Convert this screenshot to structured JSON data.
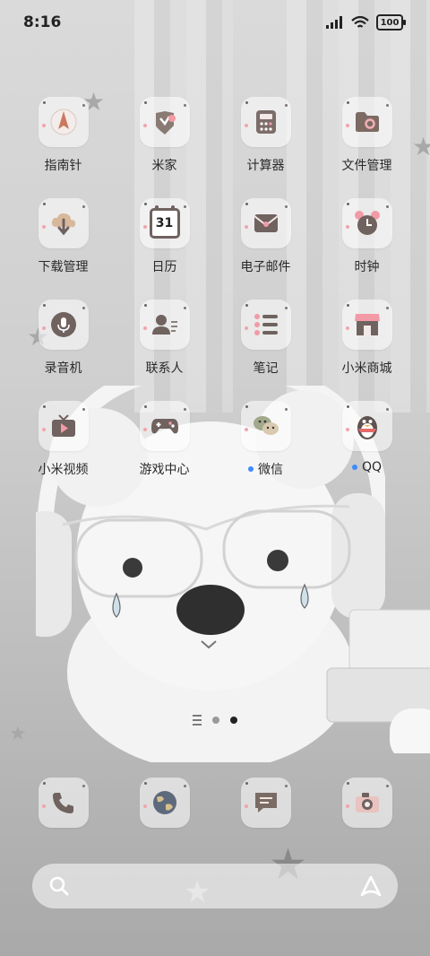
{
  "status_bar": {
    "time": "8:16",
    "battery": "100"
  },
  "apps": [
    {
      "name": "compass",
      "label": "指南针",
      "icon": "compass-icon"
    },
    {
      "name": "mi-home",
      "label": "米家",
      "icon": "mi-home-icon"
    },
    {
      "name": "calculator",
      "label": "计算器",
      "icon": "calculator-icon"
    },
    {
      "name": "file-manager",
      "label": "文件管理",
      "icon": "folder-gear-icon"
    },
    {
      "name": "downloads",
      "label": "下载管理",
      "icon": "download-cloud-icon"
    },
    {
      "name": "calendar",
      "label": "日历",
      "icon": "calendar-icon",
      "day": "31"
    },
    {
      "name": "email",
      "label": "电子邮件",
      "icon": "envelope-icon"
    },
    {
      "name": "clock",
      "label": "时钟",
      "icon": "alarm-clock-icon"
    },
    {
      "name": "recorder",
      "label": "录音机",
      "icon": "microphone-icon"
    },
    {
      "name": "contacts",
      "label": "联系人",
      "icon": "contact-icon"
    },
    {
      "name": "notes",
      "label": "笔记",
      "icon": "list-icon"
    },
    {
      "name": "mi-store",
      "label": "小米商城",
      "icon": "store-icon"
    },
    {
      "name": "mi-video",
      "label": "小米视频",
      "icon": "tv-play-icon"
    },
    {
      "name": "game-center",
      "label": "游戏中心",
      "icon": "gamepad-icon"
    },
    {
      "name": "wechat",
      "label": "微信",
      "icon": "wechat-icon",
      "new": true
    },
    {
      "name": "qq",
      "label": "QQ",
      "icon": "penguin-icon",
      "new": true
    }
  ],
  "dock": [
    {
      "name": "phone",
      "icon": "phone-icon"
    },
    {
      "name": "browser",
      "icon": "globe-icon"
    },
    {
      "name": "messages",
      "icon": "message-icon"
    },
    {
      "name": "camera",
      "icon": "camera-icon"
    }
  ],
  "search": {
    "placeholder": ""
  },
  "colors": {
    "accent_dot": "#3d8bff",
    "tile_dot": "#f0a5ac",
    "icon_brown": "#7a6a66"
  }
}
